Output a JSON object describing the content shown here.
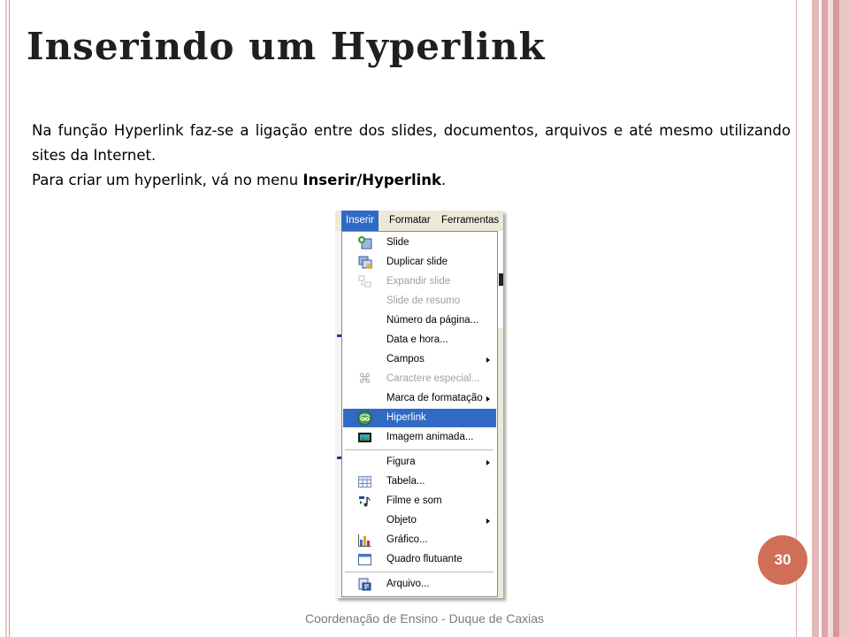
{
  "slide": {
    "title": "Inserindo um Hyperlink",
    "paragraph1": "Na função Hyperlink faz-se a ligação entre dos slides, documentos, arquivos e até mesmo utilizando sites da Internet.",
    "paragraph2_prefix": "Para criar um hyperlink, vá no menu ",
    "paragraph2_bold": "Inserir/Hyperlink",
    "paragraph2_suffix": ".",
    "page_number": "30",
    "footer": "Coordenação de Ensino - Duque de Caxias"
  },
  "menubar": {
    "items": [
      {
        "label": "Inserir",
        "active": true
      },
      {
        "label": "Formatar",
        "active": false
      },
      {
        "label": "Ferramentas",
        "active": false
      }
    ]
  },
  "menu": {
    "items": [
      {
        "label": "Slide",
        "icon": "slide-icon",
        "enabled": true,
        "submenu": false
      },
      {
        "label": "Duplicar slide",
        "icon": "duplicate-slide-icon",
        "enabled": true,
        "submenu": false
      },
      {
        "label": "Expandir slide",
        "icon": "expand-slide-icon",
        "enabled": false,
        "submenu": false
      },
      {
        "label": "Slide de resumo",
        "icon": null,
        "enabled": false,
        "submenu": false
      },
      {
        "label": "Número da página...",
        "icon": null,
        "enabled": true,
        "submenu": false
      },
      {
        "label": "Data e hora...",
        "icon": null,
        "enabled": true,
        "submenu": false
      },
      {
        "label": "Campos",
        "icon": null,
        "enabled": true,
        "submenu": true
      },
      {
        "label": "Caractere especial...",
        "icon": "special-character-icon",
        "enabled": false,
        "submenu": false
      },
      {
        "label": "Marca de formatação",
        "icon": null,
        "enabled": true,
        "submenu": true
      },
      {
        "label": "Hiperlink",
        "icon": "hyperlink-icon",
        "enabled": true,
        "submenu": false,
        "selected": true
      },
      {
        "label": "Imagem animada...",
        "icon": "animated-image-icon",
        "enabled": true,
        "submenu": false
      },
      {
        "label": "Figura",
        "icon": null,
        "enabled": true,
        "submenu": true
      },
      {
        "label": "Tabela...",
        "icon": "table-icon",
        "enabled": true,
        "submenu": false
      },
      {
        "label": "Filme e som",
        "icon": "movie-sound-icon",
        "enabled": true,
        "submenu": false
      },
      {
        "label": "Objeto",
        "icon": null,
        "enabled": true,
        "submenu": true
      },
      {
        "label": "Gráfico...",
        "icon": "chart-icon",
        "enabled": true,
        "submenu": false
      },
      {
        "label": "Quadro flutuante",
        "icon": "floating-frame-icon",
        "enabled": true,
        "submenu": false
      },
      {
        "label": "Arquivo...",
        "icon": "file-icon",
        "enabled": true,
        "submenu": false
      }
    ]
  },
  "colors": {
    "selection": "#316ac5",
    "badge": "#cf6f55",
    "frame_stripes": "#dba7a7"
  }
}
